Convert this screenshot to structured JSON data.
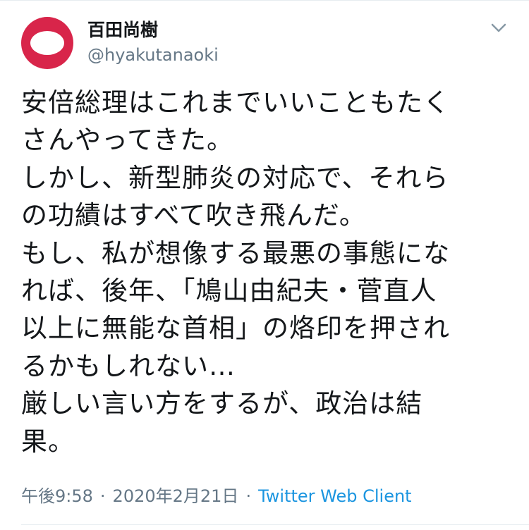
{
  "author": {
    "display_name": "百田尚樹",
    "handle": "@hyakutanaoki",
    "avatar_color": "#d8254a"
  },
  "tweet": {
    "lines": [
      "安倍総理はこれまでいいこともたく",
      "さんやってきた。",
      "しかし、新型肺炎の対応で、それら",
      "の功績はすべて吹き飛んだ。",
      "もし、私が想像する最悪の事態にな",
      "れば、後年、「鳩山由紀夫・菅直人",
      "以上に無能な首相」の烙印を押され",
      "るかもしれない…",
      "厳しい言い方をするが、政治は結",
      "果。"
    ]
  },
  "meta": {
    "time": "午後9:58",
    "separator": "·",
    "date": "2020年2月21日",
    "client": "Twitter Web Client",
    "client_color": "#1b95e0"
  },
  "icons": {
    "menu": "chevron-down-icon"
  }
}
